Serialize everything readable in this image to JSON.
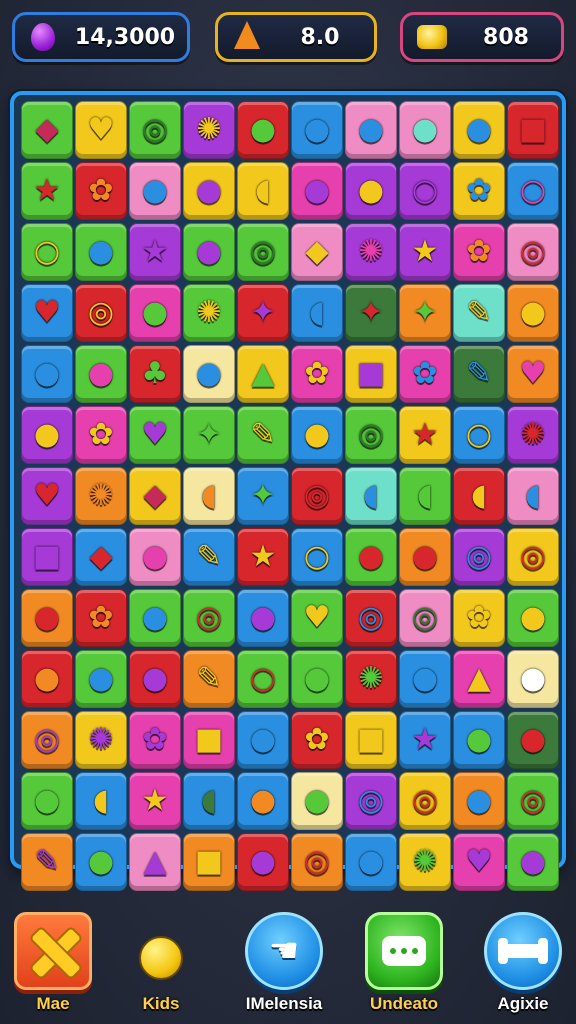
{
  "hud": {
    "gems": {
      "value": "14,3000",
      "icon": "purple-gem-icon"
    },
    "moves": {
      "value": "8.0",
      "icon": "orange-cone-icon"
    },
    "coins": {
      "value": "808",
      "icon": "gold-coins-icon"
    }
  },
  "board": {
    "columns": 10,
    "rows": 13,
    "palette": {
      "G": "#55c93a",
      "Y": "#f2c81c",
      "P": "#a63ad6",
      "R": "#d8262d",
      "B": "#2a8fe0",
      "K": "#f08cc4",
      "O": "#f28a24",
      "L": "#6ee0c9",
      "W": "#f5e6a0",
      "M": "#e63fae",
      "D": "#3b7a3a"
    },
    "glyphs": {
      "heart": "♥",
      "drop": "●",
      "star": "★",
      "flower": "✿",
      "gear": "✺",
      "candy": "◆",
      "swirl": "◎",
      "apple": "●",
      "bean": "◖",
      "blob": "✦",
      "leaf": "♣",
      "ring": "○",
      "triangle": "▲",
      "square": "■",
      "pencil": "✎"
    },
    "rows_data": [
      [
        [
          "G",
          "candy",
          "#c62a5a"
        ],
        [
          "Y",
          "heart",
          "#f2c81c"
        ],
        [
          "G",
          "swirl",
          "#2f7a2a"
        ],
        [
          "P",
          "gear",
          "#f2c81c"
        ],
        [
          "R",
          "drop",
          "#55c93a"
        ],
        [
          "B",
          "drop",
          "#2a8fe0"
        ],
        [
          "K",
          "drop",
          "#2a8fe0"
        ],
        [
          "K",
          "drop",
          "#6ee0c9"
        ],
        [
          "Y",
          "drop",
          "#2a8fe0"
        ],
        [
          "R",
          "square",
          "#d8262d"
        ]
      ],
      [
        [
          "G",
          "star",
          "#d8262d"
        ],
        [
          "R",
          "flower",
          "#f28a24"
        ],
        [
          "K",
          "drop",
          "#2a8fe0"
        ],
        [
          "Y",
          "drop",
          "#a63ad6"
        ],
        [
          "Y",
          "bean",
          "#f2c81c"
        ],
        [
          "M",
          "drop",
          "#a63ad6"
        ],
        [
          "P",
          "apple",
          "#f2c81c"
        ],
        [
          "P",
          "ring",
          "#a63ad6"
        ],
        [
          "Y",
          "flower",
          "#2a8fe0"
        ],
        [
          "B",
          "ring",
          "#e63fae"
        ]
      ],
      [
        [
          "G",
          "ring",
          "#f2c81c"
        ],
        [
          "G",
          "drop",
          "#2a8fe0"
        ],
        [
          "P",
          "star",
          "#a63ad6"
        ],
        [
          "G",
          "apple",
          "#a63ad6"
        ],
        [
          "G",
          "swirl",
          "#2f7a2a"
        ],
        [
          "K",
          "candy",
          "#f2c81c"
        ],
        [
          "P",
          "gear",
          "#e63fae"
        ],
        [
          "P",
          "star",
          "#f2c81c"
        ],
        [
          "M",
          "flower",
          "#f28a24"
        ],
        [
          "K",
          "swirl",
          "#d8262d"
        ]
      ],
      [
        [
          "B",
          "heart",
          "#d8262d"
        ],
        [
          "R",
          "swirl",
          "#f2c81c"
        ],
        [
          "M",
          "apple",
          "#55c93a"
        ],
        [
          "G",
          "gear",
          "#f2c81c"
        ],
        [
          "R",
          "blob",
          "#a63ad6"
        ],
        [
          "B",
          "bean",
          "#2a8fe0"
        ],
        [
          "D",
          "blob",
          "#d8262d"
        ],
        [
          "O",
          "blob",
          "#55c93a"
        ],
        [
          "L",
          "pencil",
          "#f2c81c"
        ],
        [
          "O",
          "drop",
          "#f2c81c"
        ]
      ],
      [
        [
          "B",
          "drop",
          "#2a8fe0"
        ],
        [
          "G",
          "drop",
          "#e63fae"
        ],
        [
          "R",
          "leaf",
          "#55c93a"
        ],
        [
          "W",
          "drop",
          "#2a8fe0"
        ],
        [
          "Y",
          "triangle",
          "#55c93a"
        ],
        [
          "M",
          "flower",
          "#f2c81c"
        ],
        [
          "Y",
          "square",
          "#a63ad6"
        ],
        [
          "M",
          "flower",
          "#2a8fe0"
        ],
        [
          "D",
          "pencil",
          "#2a8fe0"
        ],
        [
          "O",
          "heart",
          "#e63fae"
        ]
      ],
      [
        [
          "P",
          "drop",
          "#f2c81c"
        ],
        [
          "M",
          "flower",
          "#f2c81c"
        ],
        [
          "G",
          "heart",
          "#a63ad6"
        ],
        [
          "G",
          "blob",
          "#55c93a"
        ],
        [
          "G",
          "pencil",
          "#f2c81c"
        ],
        [
          "B",
          "drop",
          "#f2c81c"
        ],
        [
          "G",
          "swirl",
          "#2f7a2a"
        ],
        [
          "Y",
          "star",
          "#d8262d"
        ],
        [
          "B",
          "ring",
          "#f2c81c"
        ],
        [
          "P",
          "gear",
          "#d8262d"
        ]
      ],
      [
        [
          "P",
          "heart",
          "#d8262d"
        ],
        [
          "O",
          "gear",
          "#f28a24"
        ],
        [
          "Y",
          "candy",
          "#c62a5a"
        ],
        [
          "W",
          "bean",
          "#f28a24"
        ],
        [
          "B",
          "blob",
          "#55c93a"
        ],
        [
          "R",
          "swirl",
          "#d8262d"
        ],
        [
          "L",
          "bean",
          "#2a8fe0"
        ],
        [
          "G",
          "bean",
          "#55c93a"
        ],
        [
          "R",
          "bean",
          "#f2c81c"
        ],
        [
          "K",
          "bean",
          "#2a8fe0"
        ]
      ],
      [
        [
          "P",
          "square",
          "#a63ad6"
        ],
        [
          "B",
          "candy",
          "#d8262d"
        ],
        [
          "K",
          "apple",
          "#e63fae"
        ],
        [
          "B",
          "pencil",
          "#f2c81c"
        ],
        [
          "R",
          "star",
          "#f2c81c"
        ],
        [
          "B",
          "ring",
          "#f2c81c"
        ],
        [
          "G",
          "apple",
          "#d8262d"
        ],
        [
          "O",
          "apple",
          "#d8262d"
        ],
        [
          "P",
          "swirl",
          "#2a8fe0"
        ],
        [
          "Y",
          "swirl",
          "#d8262d"
        ]
      ],
      [
        [
          "O",
          "drop",
          "#d8262d"
        ],
        [
          "R",
          "flower",
          "#f28a24"
        ],
        [
          "G",
          "drop",
          "#2a8fe0"
        ],
        [
          "G",
          "swirl",
          "#d8262d"
        ],
        [
          "B",
          "drop",
          "#a63ad6"
        ],
        [
          "G",
          "heart",
          "#f2c81c"
        ],
        [
          "R",
          "swirl",
          "#2a8fe0"
        ],
        [
          "K",
          "swirl",
          "#2f7a2a"
        ],
        [
          "Y",
          "flower",
          "#f2c81c"
        ],
        [
          "G",
          "apple",
          "#f2c81c"
        ]
      ],
      [
        [
          "R",
          "apple",
          "#f28a24"
        ],
        [
          "G",
          "drop",
          "#2a8fe0"
        ],
        [
          "R",
          "drop",
          "#a63ad6"
        ],
        [
          "O",
          "pencil",
          "#f2c81c"
        ],
        [
          "G",
          "ring",
          "#d8262d"
        ],
        [
          "G",
          "apple",
          "#55c93a"
        ],
        [
          "R",
          "gear",
          "#55c93a"
        ],
        [
          "B",
          "drop",
          "#2a8fe0"
        ],
        [
          "M",
          "triangle",
          "#f2c81c"
        ],
        [
          "W",
          "drop",
          "#ffffff"
        ]
      ],
      [
        [
          "O",
          "swirl",
          "#a63ad6"
        ],
        [
          "Y",
          "gear",
          "#a63ad6"
        ],
        [
          "M",
          "flower",
          "#a63ad6"
        ],
        [
          "M",
          "square",
          "#f2c81c"
        ],
        [
          "B",
          "drop",
          "#2a8fe0"
        ],
        [
          "R",
          "flower",
          "#f2c81c"
        ],
        [
          "Y",
          "square",
          "#f2c81c"
        ],
        [
          "B",
          "star",
          "#a63ad6"
        ],
        [
          "B",
          "drop",
          "#55c93a"
        ],
        [
          "D",
          "apple",
          "#d8262d"
        ]
      ],
      [
        [
          "G",
          "apple",
          "#55c93a"
        ],
        [
          "B",
          "bean",
          "#f2c81c"
        ],
        [
          "M",
          "star",
          "#f2c81c"
        ],
        [
          "B",
          "bean",
          "#3b7a3a"
        ],
        [
          "B",
          "apple",
          "#f28a24"
        ],
        [
          "W",
          "apple",
          "#55c93a"
        ],
        [
          "P",
          "swirl",
          "#2a8fe0"
        ],
        [
          "Y",
          "swirl",
          "#d8262d"
        ],
        [
          "O",
          "drop",
          "#2a8fe0"
        ],
        [
          "G",
          "swirl",
          "#d8262d"
        ]
      ],
      [
        [
          "O",
          "pencil",
          "#a63ad6"
        ],
        [
          "B",
          "drop",
          "#55c93a"
        ],
        [
          "K",
          "triangle",
          "#a63ad6"
        ],
        [
          "O",
          "square",
          "#f2c81c"
        ],
        [
          "R",
          "drop",
          "#a63ad6"
        ],
        [
          "O",
          "swirl",
          "#d8262d"
        ],
        [
          "B",
          "drop",
          "#2a8fe0"
        ],
        [
          "Y",
          "gear",
          "#55c93a"
        ],
        [
          "M",
          "heart",
          "#a63ad6"
        ],
        [
          "G",
          "apple",
          "#a63ad6"
        ]
      ]
    ]
  },
  "bottom_bar": {
    "mae": {
      "label": "Mae",
      "icon": "crossed-sticks-icon"
    },
    "kids": {
      "label": "Kids",
      "icon": "lemon-icon"
    },
    "melensia": {
      "label": "IMelensia",
      "icon": "hand-pointer-icon"
    },
    "undo": {
      "label": "Undeato",
      "icon": "chat-bubble-icon"
    },
    "agixie": {
      "label": "Agixie",
      "icon": "bone-icon"
    }
  }
}
